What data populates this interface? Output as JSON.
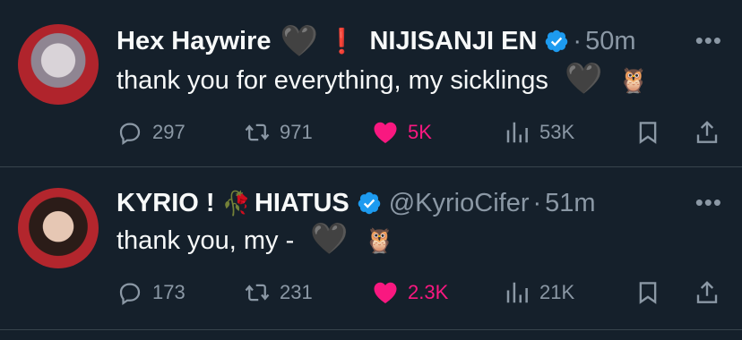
{
  "tweets": [
    {
      "name": "Hex Haywire",
      "name_emoji": "🖤",
      "tag_emoji": "❗",
      "tag": "NIJISANJI EN",
      "handle": "",
      "time": "50m",
      "text": "thank you for everything, my sicklings",
      "text_emojis": [
        "🖤",
        "🦉"
      ],
      "replies": "297",
      "retweets": "971",
      "likes": "5K",
      "views": "53K"
    },
    {
      "name": "KYRIO !",
      "name_emoji": "🥀",
      "tag": "HIATUS",
      "handle": "@KyrioCifer",
      "time": "51m",
      "text": "thank you, my -",
      "text_emojis": [
        "🖤",
        "🦉"
      ],
      "replies": "173",
      "retweets": "231",
      "likes": "2.3K",
      "views": "21K"
    }
  ],
  "colors": {
    "background": "#15202b",
    "muted": "#8b98a5",
    "like": "#f91880",
    "verified": "#1d9bf0"
  }
}
